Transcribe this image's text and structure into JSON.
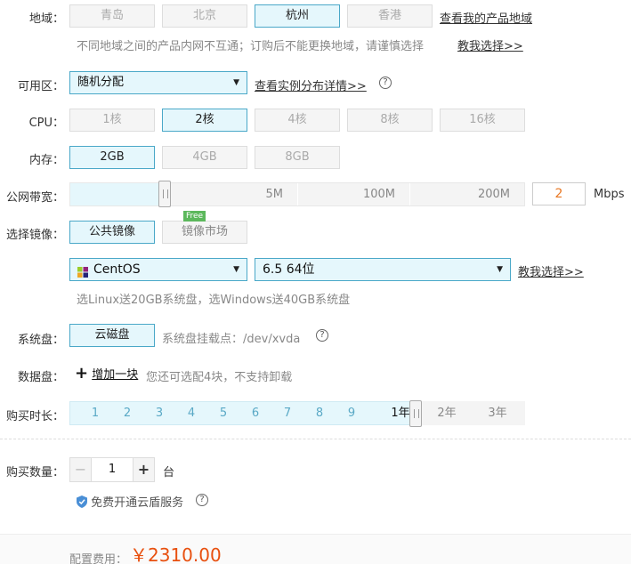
{
  "region": {
    "label": "地域：",
    "options": [
      "青岛",
      "北京",
      "杭州",
      "香港"
    ],
    "selected": "杭州",
    "view_link": "查看我的产品地域",
    "note": "不同地域之间的产品内网不互通；订购后不能更换地域，请谨慎选择",
    "help_link": "教我选择>>"
  },
  "zone": {
    "label": "可用区：",
    "value": "随机分配",
    "detail_link": "查看实例分布详情>>",
    "help_icon": "question-circle-icon"
  },
  "cpu": {
    "label": "CPU：",
    "options": [
      "1核",
      "2核",
      "4核",
      "8核",
      "16核"
    ],
    "selected": "2核"
  },
  "memory": {
    "label": "内存：",
    "options": [
      "2GB",
      "4GB",
      "8GB"
    ],
    "selected": "2GB"
  },
  "bandwidth": {
    "label": "公网带宽：",
    "marks": [
      "5M",
      "100M",
      "200M"
    ],
    "value": "2",
    "unit": "Mbps"
  },
  "image": {
    "label": "选择镜像：",
    "tabs": [
      "公共镜像",
      "镜像市场"
    ],
    "selected_tab": "公共镜像",
    "free_badge": "Free",
    "os": "CentOS",
    "version": "6.5 64位",
    "help_link": "教我选择>>",
    "note": "选Linux送20GB系统盘，选Windows送40GB系统盘"
  },
  "system_disk": {
    "label": "系统盘：",
    "type": "云磁盘",
    "mount_label": "系统盘挂载点：/dev/xvda"
  },
  "data_disk": {
    "label": "数据盘：",
    "add_label": "增加一块",
    "note": "您还可选配4块，不支持卸载"
  },
  "duration": {
    "label": "购买时长：",
    "months": [
      "1",
      "2",
      "3",
      "4",
      "5",
      "6",
      "7",
      "8",
      "9"
    ],
    "selected_label": "1年",
    "years": [
      "2年",
      "3年"
    ]
  },
  "quantity": {
    "label": "购买数量：",
    "value": "1",
    "unit": "台",
    "service_label": "免费开通云盾服务"
  },
  "footer": {
    "cost_label": "配置费用：",
    "price": "￥2310.00"
  },
  "colors": {
    "accent": "#4aa8c8",
    "selected_bg": "#e5f7fc",
    "price": "#e8500f",
    "bandwidth_value": "#e87722"
  }
}
